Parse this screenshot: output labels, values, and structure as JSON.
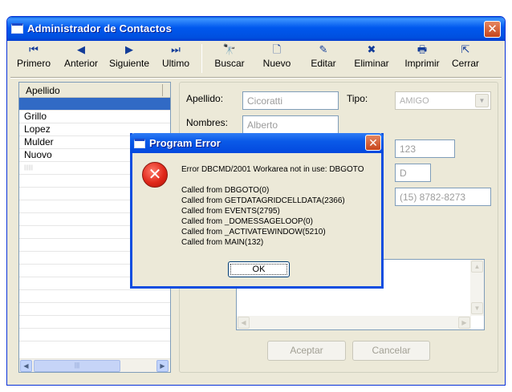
{
  "window": {
    "title": "Administrador de Contactos",
    "close": "✕"
  },
  "toolbar": {
    "items": [
      {
        "label": "Primero",
        "icon": "⏮"
      },
      {
        "label": "Anterior",
        "icon": "◀"
      },
      {
        "label": "Siguiente",
        "icon": "▶"
      },
      {
        "label": "Ultimo",
        "icon": "⏭"
      },
      {
        "label": "Buscar",
        "icon": "🔭"
      },
      {
        "label": "Nuevo",
        "icon": "🗋"
      },
      {
        "label": "Editar",
        "icon": "✎"
      },
      {
        "label": "Eliminar",
        "icon": "✖"
      },
      {
        "label": "Imprimir",
        "icon": "🖶"
      },
      {
        "label": "Cerrar",
        "icon": "⇱"
      }
    ]
  },
  "list": {
    "header": "Apellido",
    "rows": [
      "",
      "Grillo",
      "Lopez",
      "Mulder",
      "Nuovo",
      "||||||"
    ],
    "thumb_grip": "|||"
  },
  "form": {
    "apellido_label": "Apellido:",
    "apellido_value": "Cicoratti",
    "tipo_label": "Tipo:",
    "tipo_value": "AMIGO",
    "nombres_label": "Nombres:",
    "nombres_value": "Alberto",
    "numero_value": "123",
    "piso_value": "D",
    "telefono_value": "(15) 8782-8273",
    "accept_label": "Aceptar",
    "cancel_label": "Cancelar"
  },
  "dialog": {
    "title": "Program Error",
    "close": "✕",
    "icon": "✕",
    "message": "Error DBCMD/2001  Workarea not in use: DBGOTO",
    "calls": [
      "Called from DBGOTO(0)",
      "Called from GETDATAGRIDCELLDATA(2366)",
      "Called from EVENTS(2795)",
      "Called from _DOMESSAGELOOP(0)",
      "Called from _ACTIVATEWINDOW(5210)",
      "Called from MAIN(132)"
    ],
    "ok_label": "OK"
  },
  "scroll": {
    "left": "◀",
    "right": "▶",
    "up": "▲",
    "down": "▼"
  }
}
